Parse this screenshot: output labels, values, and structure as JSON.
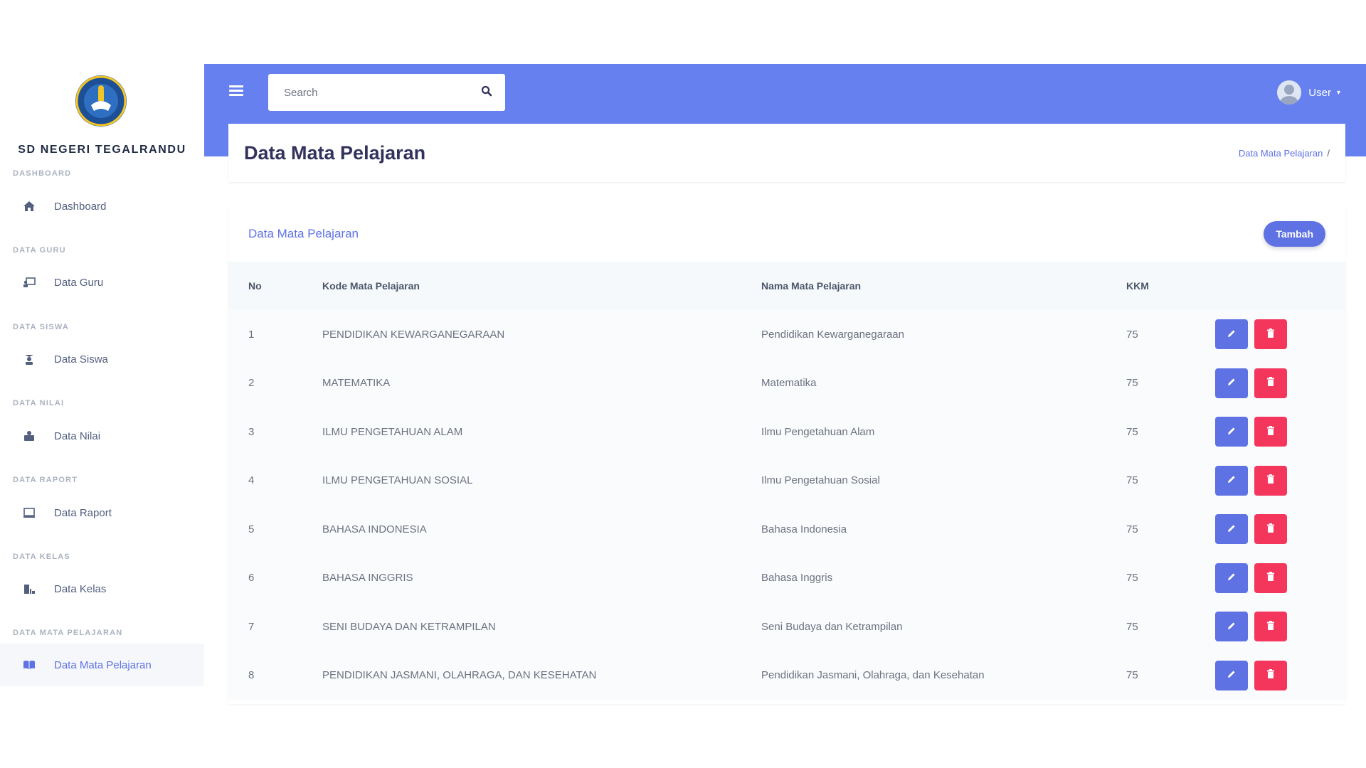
{
  "sidebar": {
    "brand": "SD NEGERI TEGALRANDU",
    "sections": [
      {
        "heading": "DASHBOARD",
        "item": "Dashboard",
        "icon": "home-icon"
      },
      {
        "heading": "DATA GURU",
        "item": "Data Guru",
        "icon": "chalkboard-teacher-icon"
      },
      {
        "heading": "DATA SISWA",
        "item": "Data Siswa",
        "icon": "student-icon"
      },
      {
        "heading": "DATA NILAI",
        "item": "Data Nilai",
        "icon": "grades-icon"
      },
      {
        "heading": "DATA RAPORT",
        "item": "Data Raport",
        "icon": "report-icon"
      },
      {
        "heading": "DATA KELAS",
        "item": "Data Kelas",
        "icon": "classroom-icon"
      },
      {
        "heading": "DATA MATA PELAJARAN",
        "item": "Data Mata Pelajaran",
        "icon": "book-open-icon"
      }
    ],
    "active_item": "Data Mata Pelajaran"
  },
  "topbar": {
    "search_placeholder": "Search",
    "user_label": "User"
  },
  "page": {
    "title": "Data Mata Pelajaran",
    "breadcrumb": "Data Mata Pelajaran",
    "breadcrumb_sep": "/"
  },
  "table_card": {
    "title": "Data Mata Pelajaran",
    "add_button": "Tambah",
    "columns": [
      "No",
      "Kode Mata Pelajaran",
      "Nama Mata Pelajaran",
      "KKM"
    ],
    "rows": [
      {
        "no": "1",
        "kode": "PENDIDIKAN KEWARGANEGARAAN",
        "nama": "Pendidikan Kewarganegaraan",
        "kkm": "75"
      },
      {
        "no": "2",
        "kode": "MATEMATIKA",
        "nama": "Matematika",
        "kkm": "75"
      },
      {
        "no": "3",
        "kode": "ILMU PENGETAHUAN ALAM",
        "nama": "Ilmu Pengetahuan Alam",
        "kkm": "75"
      },
      {
        "no": "4",
        "kode": "ILMU PENGETAHUAN SOSIAL",
        "nama": "Ilmu Pengetahuan Sosial",
        "kkm": "75"
      },
      {
        "no": "5",
        "kode": "BAHASA INDONESIA",
        "nama": "Bahasa Indonesia",
        "kkm": "75"
      },
      {
        "no": "6",
        "kode": "BAHASA INGGRIS",
        "nama": "Bahasa Inggris",
        "kkm": "75"
      },
      {
        "no": "7",
        "kode": "SENI BUDAYA DAN KETRAMPILAN",
        "nama": "Seni Budaya dan Ketrampilan",
        "kkm": "75"
      },
      {
        "no": "8",
        "kode": "PENDIDIKAN JASMANI, OLAHRAGA, DAN KESEHATAN",
        "nama": "Pendidikan Jasmani, Olahraga, dan Kesehatan",
        "kkm": "75"
      }
    ]
  },
  "colors": {
    "primary": "#5e72e4",
    "topbar": "#6680f0",
    "danger": "#f5365c"
  }
}
